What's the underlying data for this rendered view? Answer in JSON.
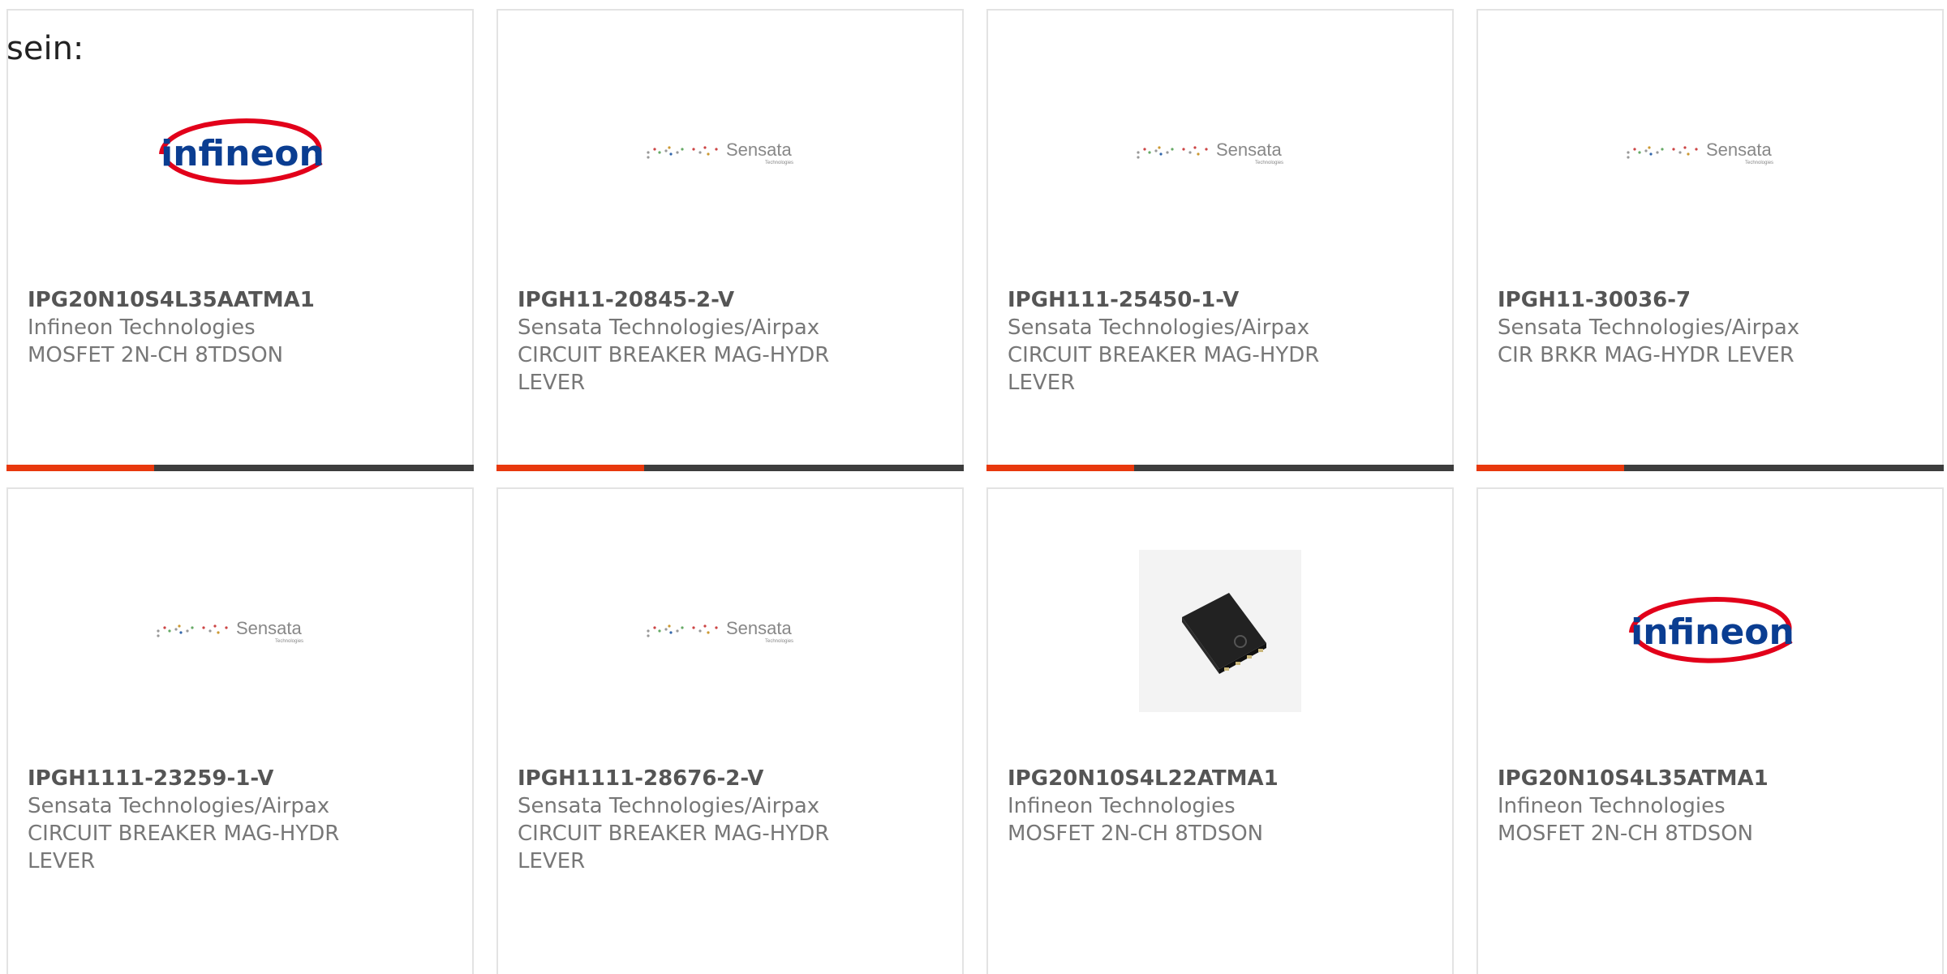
{
  "intro": "sein:",
  "products": [
    {
      "part_number": "IPG20N10S4L35AATMA1",
      "manufacturer": "Infineon Technologies",
      "description": "MOSFET 2N-CH 8TDSON",
      "image": "infineon-logo",
      "logo_text": "infineon"
    },
    {
      "part_number": "IPGH11-20845-2-V",
      "manufacturer": "Sensata Technologies/Airpax",
      "description": "CIRCUIT BREAKER MAG-HYDR LEVER",
      "image": "sensata-logo",
      "logo_text": "Sensata",
      "logo_subtext": "Technologies"
    },
    {
      "part_number": "IPGH111-25450-1-V",
      "manufacturer": "Sensata Technologies/Airpax",
      "description": "CIRCUIT BREAKER MAG-HYDR LEVER",
      "image": "sensata-logo",
      "logo_text": "Sensata",
      "logo_subtext": "Technologies"
    },
    {
      "part_number": "IPGH11-30036-7",
      "manufacturer": "Sensata Technologies/Airpax",
      "description": "CIR BRKR MAG-HYDR LEVER",
      "image": "sensata-logo",
      "logo_text": "Sensata",
      "logo_subtext": "Technologies"
    },
    {
      "part_number": "IPGH1111-23259-1-V",
      "manufacturer": "Sensata Technologies/Airpax",
      "description": "CIRCUIT BREAKER MAG-HYDR LEVER",
      "image": "sensata-logo",
      "logo_text": "Sensata",
      "logo_subtext": "Technologies"
    },
    {
      "part_number": "IPGH1111-28676-2-V",
      "manufacturer": "Sensata Technologies/Airpax",
      "description": "CIRCUIT BREAKER MAG-HYDR LEVER",
      "image": "sensata-logo",
      "logo_text": "Sensata",
      "logo_subtext": "Technologies"
    },
    {
      "part_number": "IPG20N10S4L22ATMA1",
      "manufacturer": "Infineon Technologies",
      "description": "MOSFET 2N-CH 8TDSON",
      "image": "chip-photo"
    },
    {
      "part_number": "IPG20N10S4L35ATMA1",
      "manufacturer": "Infineon Technologies",
      "description": "MOSFET 2N-CH 8TDSON",
      "image": "infineon-logo",
      "logo_text": "infineon"
    }
  ],
  "colors": {
    "accent": "#e8380d",
    "bar": "#3d3d3d",
    "infineon_red": "#e2001a",
    "infineon_blue": "#0a3d91"
  }
}
